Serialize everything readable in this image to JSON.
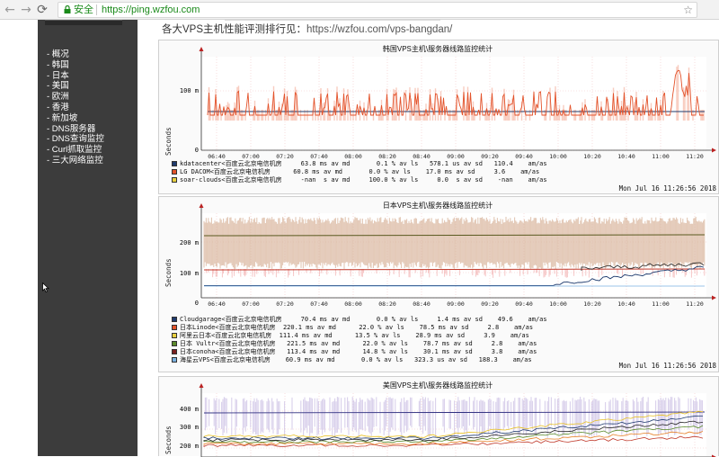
{
  "browser": {
    "secure_label": "安全",
    "url": "https://ping.wzfou.com",
    "icons": [
      "back-arrow-icon",
      "forward-arrow-icon",
      "reload-icon",
      "lock-icon",
      "star-icon"
    ]
  },
  "sidebar": {
    "items": [
      {
        "label": "- 概况"
      },
      {
        "label": "- 韩国"
      },
      {
        "label": "- 日本"
      },
      {
        "label": "- 美国"
      },
      {
        "label": "- 欧洲"
      },
      {
        "label": "- 香港"
      },
      {
        "label": "- 新加坡"
      },
      {
        "label": "- DNS服务器"
      },
      {
        "label": "- DNS查询监控"
      },
      {
        "label": "- Curl抓取监控"
      },
      {
        "label": "- 三大网络监控"
      }
    ]
  },
  "heading": {
    "text": "各大VPS主机性能评测排行见：",
    "link": "https://wzfou.com/vps-bangdan/"
  },
  "timestamp": "Mon Jul 16 11:26:56 2018",
  "xticks": [
    "06:40",
    "07:00",
    "07:20",
    "07:40",
    "08:00",
    "08:20",
    "08:40",
    "09:00",
    "09:20",
    "09:40",
    "10:00",
    "10:20",
    "10:40",
    "11:00",
    "11:20"
  ],
  "panels": [
    {
      "title": "韩国VPS主机\\服务器线路监控统计",
      "ylabel": "Seconds",
      "yticks": [
        "100 m",
        "0"
      ],
      "legend": [
        {
          "color": "#1f3b6e",
          "name": "kdatacenter<百度云北京电信机房",
          "stats": "     63.8 ms av md       0.1 % av ls   578.1 us av sd   110.4    am/as"
        },
        {
          "color": "#e3522a",
          "name": "LG DACOM<百度云北京电信机房",
          "stats": "      60.8 ms av md       0.0 % av ls    17.0 ms av sd     3.6    am/as"
        },
        {
          "color": "#e8d040",
          "name": "soar-clouds<百度云北京电信机房",
          "stats": "     -nan  s av md     100.0 % av ls     0.0  s av sd    -nan    am/as"
        }
      ]
    },
    {
      "title": "日本VPS主机\\服务器线路监控统计",
      "ylabel": "Seconds",
      "yticks": [
        "200 m",
        "100 m",
        "0"
      ],
      "legend": [
        {
          "color": "#1f3b6e",
          "name": "Cloudgarage<百度云北京电信机房",
          "stats": "     70.4 ms av md       0.0 % av ls     1.4 ms av sd    49.6    am/as"
        },
        {
          "color": "#e3522a",
          "name": "日本Linode<百度云北京电信机房",
          "stats": "  220.1 ms av md      22.0 % av ls    78.5 ms av sd     2.8    am/as"
        },
        {
          "color": "#e8d040",
          "name": "阿里云日本<百度云北京电信机房",
          "stats": "  111.4 ms av md      13.5 % av ls    28.9 ms av sd     3.9    am/as"
        },
        {
          "color": "#5a8a2a",
          "name": "日本 Vultr<百度云北京电信机房",
          "stats": "   221.5 ms av md      22.0 % av ls    78.7 ms av sd     2.8    am/as"
        },
        {
          "color": "#7a2020",
          "name": "日本conoha<百度云北京电信机房",
          "stats": "   113.4 ms av md      14.8 % av ls    30.1 ms av sd     3.8    am/as"
        },
        {
          "color": "#7ab0e0",
          "name": "海星云VPS<百度云北京电信机房",
          "stats": "    60.9 ms av md       0.0 % av ls   323.3 us av sd   188.3    am/as"
        }
      ]
    },
    {
      "title": "美国VPS主机\\服务器线路监控统计",
      "ylabel": "Seconds",
      "yticks": [
        "400 m",
        "300 m",
        "200 m"
      ]
    }
  ],
  "colors": {
    "sidebar_bg": "#3c3c3c",
    "secure_green": "#1a8a1a",
    "korea_main": "#e3522a",
    "korea_band": "#f5b7a5",
    "korea_baseline": "#1f3b6e",
    "japan_band": "#d8b49c",
    "us_band": "#cfc4e6"
  }
}
